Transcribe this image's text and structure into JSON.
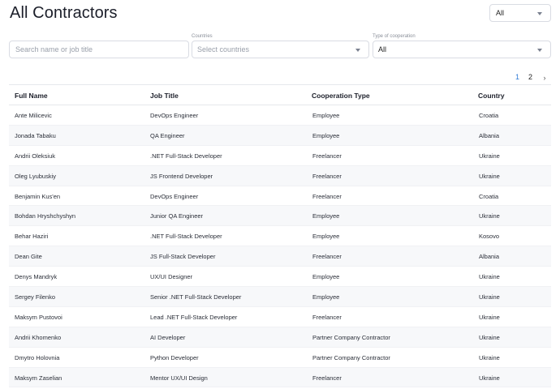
{
  "header": {
    "title": "All Contractors",
    "top_select_value": "All"
  },
  "filters": {
    "search_placeholder": "Search name or job title",
    "countries_label": "Countries",
    "countries_placeholder": "Select countries",
    "cooperation_label": "Type of cooperation",
    "cooperation_value": "All"
  },
  "pagination": {
    "pages": [
      "1",
      "2"
    ],
    "current": "1",
    "next_glyph": "›"
  },
  "table": {
    "columns": [
      "Full Name",
      "Job Title",
      "Cooperation Type",
      "Country"
    ],
    "rows": [
      [
        "Ante Milicevic",
        "DevOps Engineer",
        "Employee",
        "Croatia"
      ],
      [
        "Jonada Tabaku",
        "QA Engineer",
        "Employee",
        "Albania"
      ],
      [
        "Andrii Oleksiuk",
        ".NET Full-Stack Developer",
        "Freelancer",
        "Ukraine"
      ],
      [
        "Oleg Lyubuskiy",
        "JS Frontend Developer",
        "Freelancer",
        "Ukraine"
      ],
      [
        "Benjamin Kus'en",
        "DevOps Engineer",
        "Freelancer",
        "Croatia"
      ],
      [
        "Bohdan Hryshchyshyn",
        "Junior QA Engineer",
        "Employee",
        "Ukraine"
      ],
      [
        "Behar Haziri",
        ".NET Full-Stack Developer",
        "Employee",
        "Kosovo"
      ],
      [
        "Dean Gite",
        "JS Full-Stack Developer",
        "Freelancer",
        "Albania"
      ],
      [
        "Denys Mandryk",
        "UX/UI Designer",
        "Employee",
        "Ukraine"
      ],
      [
        "Sergey Filenko",
        "Senior .NET Full-Stack Developer",
        "Employee",
        "Ukraine"
      ],
      [
        "Maksym Pustovoi",
        "Lead .NET Full-Stack Developer",
        "Freelancer",
        "Ukraine"
      ],
      [
        "Andrii Khomenko",
        "AI Developer",
        "Partner Company Contractor",
        "Ukraine"
      ],
      [
        "Dmytro Holovnia",
        "Python Developer",
        "Partner Company Contractor",
        "Ukraine"
      ],
      [
        "Maksym Zaselian",
        "Mentor UX/UI Design",
        "Freelancer",
        "Ukraine"
      ]
    ]
  }
}
